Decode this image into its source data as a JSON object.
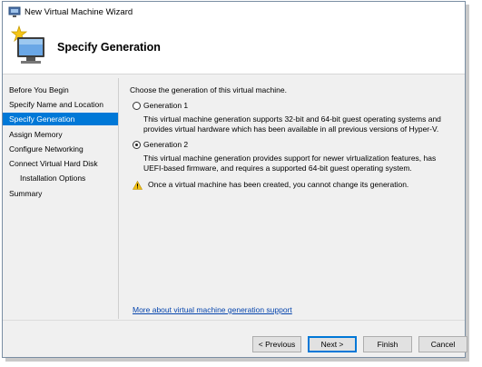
{
  "window": {
    "title": "New Virtual Machine Wizard"
  },
  "header": {
    "heading": "Specify Generation"
  },
  "sidebar": {
    "items": [
      {
        "label": "Before You Begin"
      },
      {
        "label": "Specify Name and Location"
      },
      {
        "label": "Specify Generation"
      },
      {
        "label": "Assign Memory"
      },
      {
        "label": "Configure Networking"
      },
      {
        "label": "Connect Virtual Hard Disk"
      },
      {
        "label": "Installation Options"
      },
      {
        "label": "Summary"
      }
    ],
    "active": "Specify Generation"
  },
  "main": {
    "intro": "Choose the generation of this virtual machine.",
    "options": [
      {
        "label": "Generation 1",
        "selected": false,
        "description": "This virtual machine generation supports 32-bit and 64-bit guest operating systems and provides virtual hardware which has been available in all previous versions of Hyper-V."
      },
      {
        "label": "Generation 2",
        "selected": true,
        "description": "This virtual machine generation provides support for newer virtualization features, has UEFI-based firmware, and requires a supported 64-bit guest operating system."
      }
    ],
    "warning": "Once a virtual machine has been created, you cannot change its generation.",
    "link": "More about virtual machine generation support"
  },
  "buttons": {
    "previous": "< Previous",
    "next": "Next >",
    "finish": "Finish",
    "cancel": "Cancel"
  },
  "colors": {
    "selection": "#0078d7",
    "link": "#0645ad",
    "warning": "#f2c010"
  }
}
